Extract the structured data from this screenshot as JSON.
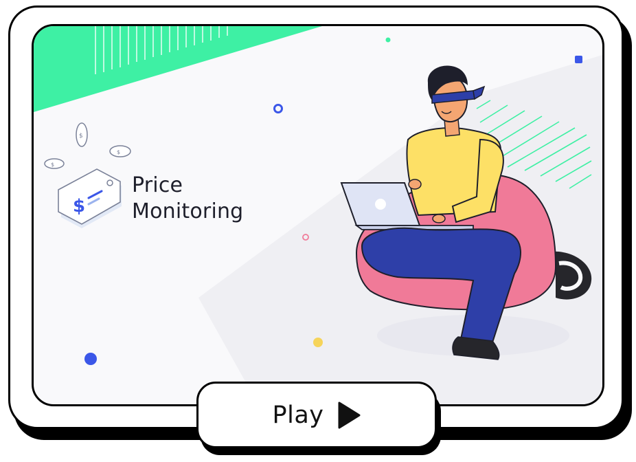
{
  "video": {
    "title_line1": "Price",
    "title_line2": "Monitoring",
    "illustration_icons": [
      "price-tag-icon",
      "dollar-coin-icon",
      "person-with-laptop"
    ]
  },
  "controls": {
    "play_label": "Play",
    "play_icon": "play-triangle-icon"
  },
  "colors": {
    "accent_green": "#3ef0a4",
    "dot_blue": "#3b57e8",
    "dot_yellow": "#f6d45a",
    "shirt_yellow": "#fde066",
    "pants_navy": "#2e3fa8",
    "beanbag_pink": "#f07a98",
    "frame_black": "#000000"
  }
}
